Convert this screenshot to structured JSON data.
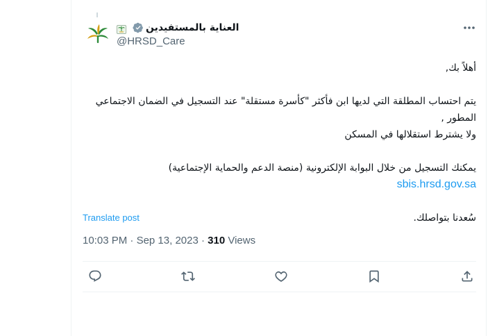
{
  "author": {
    "display_name": "العناية بالمستفيدين",
    "handle": "@HRSD_Care",
    "verified_icon": "verified-badge-icon",
    "flag_emoji_icon": "palm-tree-flag-icon",
    "avatar_icon": "hrsd-logo-icon"
  },
  "tweet": {
    "greeting": "أهلاً بك,",
    "paragraph1_line1": "يتم احتساب المطلقة التي لديها ابن فأكثر \"كأسرة مستقلة\" عند التسجيل في الضمان الاجتماعي المطور ,",
    "paragraph1_line2": "ولا يشترط استقلالها في المسكن",
    "paragraph2_line1": "يمكنك التسجيل من خلال البوابة الإلكترونية (منصة الدعم والحماية الإجتماعية)",
    "link": "sbis.hrsd.gov.sa",
    "closing": "سُعدنا بتواصلك."
  },
  "translate_label": "Translate post",
  "meta": {
    "time": "10:03 PM",
    "separator": "·",
    "date": "Sep 13, 2023",
    "views_count": "310",
    "views_label": "Views"
  },
  "colors": {
    "accent": "#1d9bf0",
    "text": "#0f1419",
    "muted": "#536471",
    "border": "#eff3f4",
    "logo_green": "#2e8b3a",
    "logo_gold": "#d4a017"
  },
  "actions": {
    "reply_icon": "reply-icon",
    "repost_icon": "repost-icon",
    "like_icon": "heart-icon",
    "bookmark_icon": "bookmark-icon",
    "share_icon": "share-icon",
    "more_icon": "more-horizontal-icon"
  }
}
